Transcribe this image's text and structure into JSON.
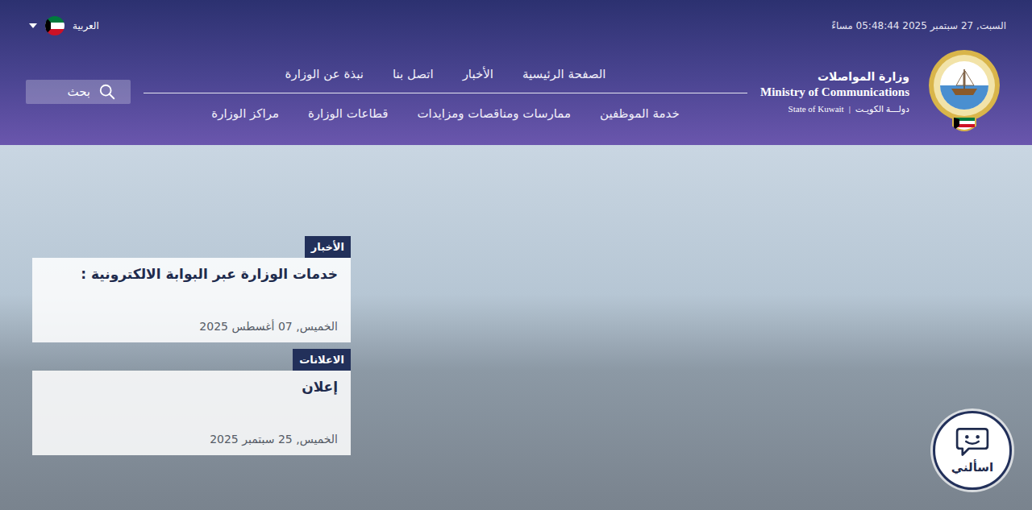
{
  "top_bar": {
    "datetime": "السبت, 27 سبتمبر 2025 05:48:44 مساءً",
    "language": {
      "label": "العربية"
    }
  },
  "logo": {
    "name_ar": "وزارة المواصلات",
    "name_en": "Ministry of Communications",
    "country_en": "State of Kuwait",
    "separator": "|",
    "country_ar": "دولـــة الكويـت"
  },
  "nav": {
    "primary": [
      "الصفحة الرئيسية",
      "الأخبار",
      "اتصل بنا",
      "نبذة عن الوزارة"
    ],
    "secondary": [
      "خدمة الموظفين",
      "ممارسات ومناقصات ومزايدات",
      "قطاعات الوزارة",
      "مراكز الوزارة"
    ]
  },
  "search": {
    "label": "بحث"
  },
  "hero_cards": [
    {
      "tag": "الأخبار",
      "title": "خدمات الوزارة عبر البوابة الالكترونية :",
      "date": "الخميس, 07 أغسطس 2025"
    },
    {
      "tag": "الاعلانات",
      "title": "إعلان",
      "date": "الخميس, 25 سبتمبر 2025"
    }
  ],
  "chatbot": {
    "label": "اسألني"
  }
}
